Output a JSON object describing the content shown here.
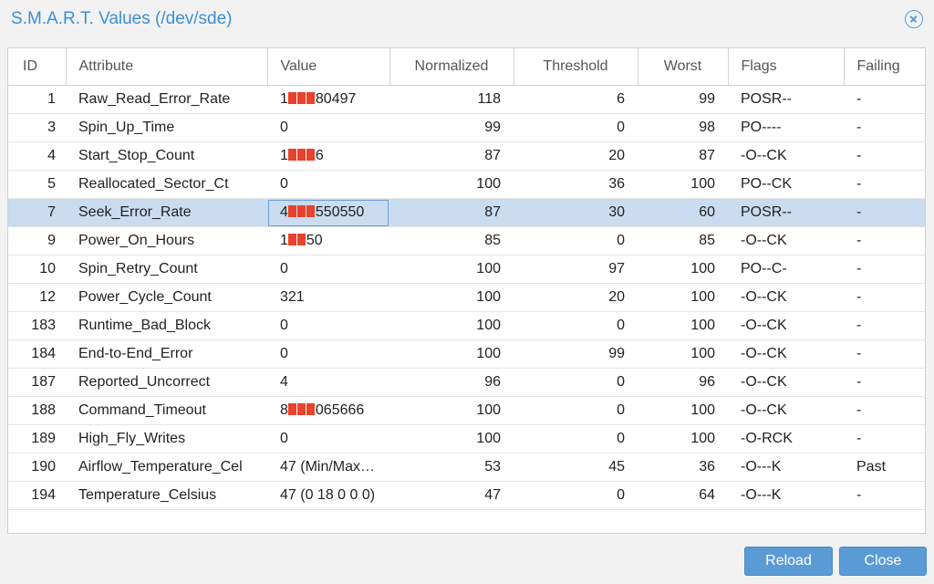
{
  "window": {
    "title": "S.M.A.R.T. Values (/dev/sde)"
  },
  "columns": [
    "ID",
    "Attribute",
    "Value",
    "Normalized",
    "Threshold",
    "Worst",
    "Flags",
    "Failing"
  ],
  "rows": [
    {
      "id": "1",
      "attribute": "Raw_Read_Error_Rate",
      "value_prefix": "1",
      "redacted": 3,
      "value_suffix": "80497",
      "normalized": "118",
      "threshold": "6",
      "worst": "99",
      "flags": "POSR--",
      "failing": "-"
    },
    {
      "id": "3",
      "attribute": "Spin_Up_Time",
      "value_prefix": "0",
      "redacted": 0,
      "value_suffix": "",
      "normalized": "99",
      "threshold": "0",
      "worst": "98",
      "flags": "PO----",
      "failing": "-"
    },
    {
      "id": "4",
      "attribute": "Start_Stop_Count",
      "value_prefix": "1",
      "redacted": 3,
      "value_suffix": "6",
      "normalized": "87",
      "threshold": "20",
      "worst": "87",
      "flags": "-O--CK",
      "failing": "-"
    },
    {
      "id": "5",
      "attribute": "Reallocated_Sector_Ct",
      "value_prefix": "0",
      "redacted": 0,
      "value_suffix": "",
      "normalized": "100",
      "threshold": "36",
      "worst": "100",
      "flags": "PO--CK",
      "failing": "-"
    },
    {
      "id": "7",
      "attribute": "Seek_Error_Rate",
      "value_prefix": "4",
      "redacted": 3,
      "value_suffix": "550550",
      "normalized": "87",
      "threshold": "30",
      "worst": "60",
      "flags": "POSR--",
      "failing": "-",
      "selected": true
    },
    {
      "id": "9",
      "attribute": "Power_On_Hours",
      "value_prefix": "1",
      "redacted": 2,
      "value_suffix": "50",
      "normalized": "85",
      "threshold": "0",
      "worst": "85",
      "flags": "-O--CK",
      "failing": "-"
    },
    {
      "id": "10",
      "attribute": "Spin_Retry_Count",
      "value_prefix": "0",
      "redacted": 0,
      "value_suffix": "",
      "normalized": "100",
      "threshold": "97",
      "worst": "100",
      "flags": "PO--C-",
      "failing": "-"
    },
    {
      "id": "12",
      "attribute": "Power_Cycle_Count",
      "value_prefix": "321",
      "redacted": 0,
      "value_suffix": "",
      "normalized": "100",
      "threshold": "20",
      "worst": "100",
      "flags": "-O--CK",
      "failing": "-"
    },
    {
      "id": "183",
      "attribute": "Runtime_Bad_Block",
      "value_prefix": "0",
      "redacted": 0,
      "value_suffix": "",
      "normalized": "100",
      "threshold": "0",
      "worst": "100",
      "flags": "-O--CK",
      "failing": "-"
    },
    {
      "id": "184",
      "attribute": "End-to-End_Error",
      "value_prefix": "0",
      "redacted": 0,
      "value_suffix": "",
      "normalized": "100",
      "threshold": "99",
      "worst": "100",
      "flags": "-O--CK",
      "failing": "-"
    },
    {
      "id": "187",
      "attribute": "Reported_Uncorrect",
      "value_prefix": "4",
      "redacted": 0,
      "value_suffix": "",
      "normalized": "96",
      "threshold": "0",
      "worst": "96",
      "flags": "-O--CK",
      "failing": "-"
    },
    {
      "id": "188",
      "attribute": "Command_Timeout",
      "value_prefix": "8",
      "redacted": 3,
      "value_suffix": "065666",
      "normalized": "100",
      "threshold": "0",
      "worst": "100",
      "flags": "-O--CK",
      "failing": "-"
    },
    {
      "id": "189",
      "attribute": "High_Fly_Writes",
      "value_prefix": "0",
      "redacted": 0,
      "value_suffix": "",
      "normalized": "100",
      "threshold": "0",
      "worst": "100",
      "flags": "-O-RCK",
      "failing": "-"
    },
    {
      "id": "190",
      "attribute": "Airflow_Temperature_Cel",
      "value_prefix": "47 (Min/Max…",
      "redacted": 0,
      "value_suffix": "",
      "normalized": "53",
      "threshold": "45",
      "worst": "36",
      "flags": "-O---K",
      "failing": "Past"
    },
    {
      "id": "194",
      "attribute": "Temperature_Celsius",
      "value_prefix": "47 (0 18 0 0 0)",
      "redacted": 0,
      "value_suffix": "",
      "normalized": "47",
      "threshold": "0",
      "worst": "64",
      "flags": "-O---K",
      "failing": "-"
    }
  ],
  "buttons": {
    "reload": "Reload",
    "close": "Close"
  },
  "icons": {
    "close": "close-circle-icon"
  },
  "colors": {
    "accent": "#3a8fd6",
    "button": "#5b9bd5",
    "selected_row": "#c9dcf0",
    "redaction": "#e8412c"
  }
}
